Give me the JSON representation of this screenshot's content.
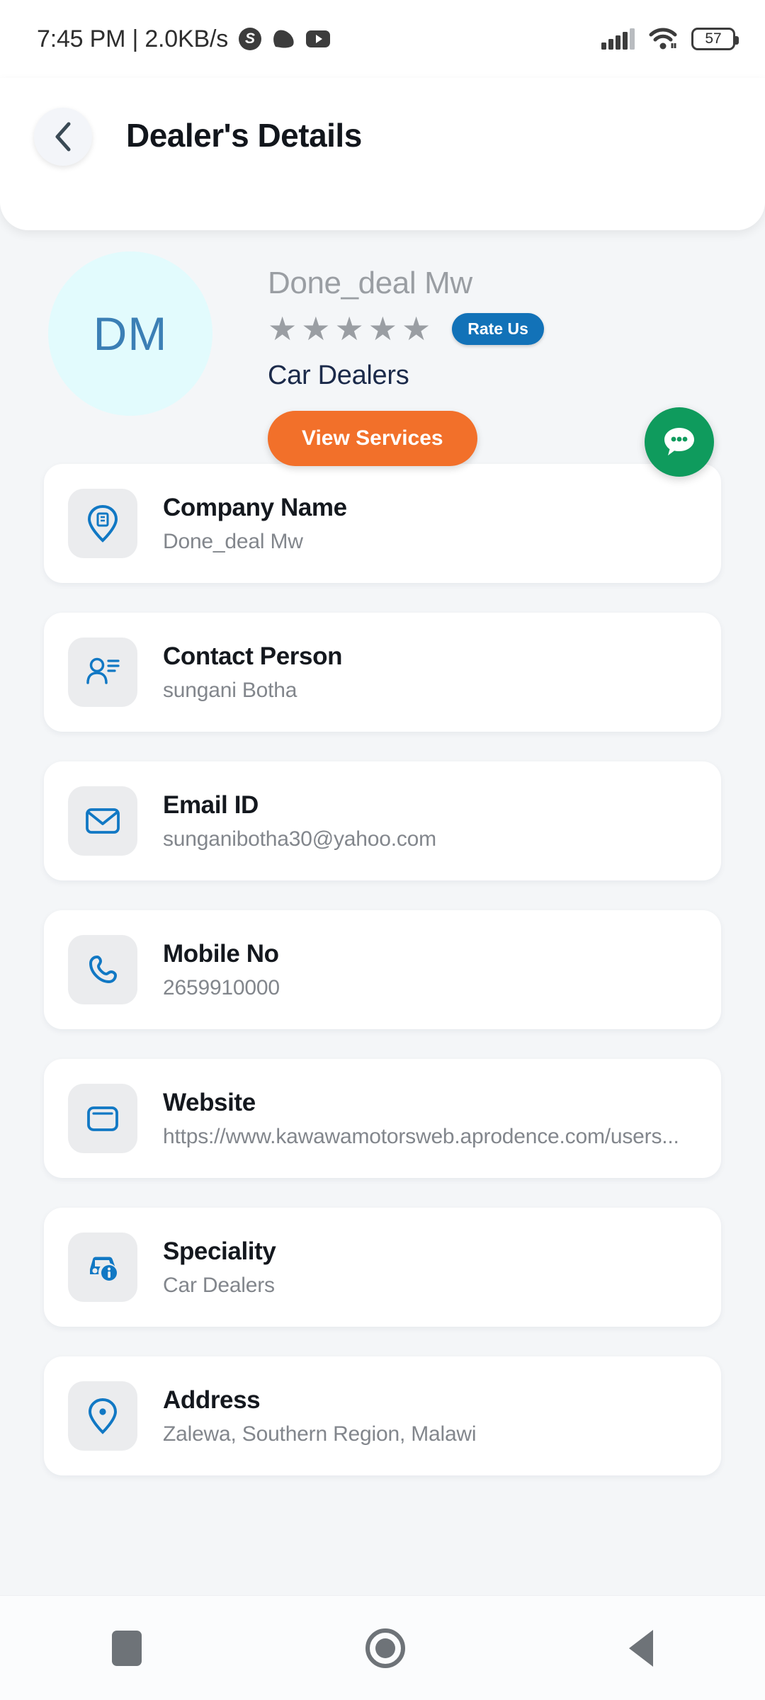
{
  "statusbar": {
    "clock": "7:45 PM | 2.0KB/s",
    "skype_icon": "skype-icon",
    "game_icon": "game-controller-icon",
    "youtube_icon": "youtube-icon",
    "signal_icon": "signal-bars-icon",
    "wifi_icon": "wifi-icon",
    "battery_level": "57"
  },
  "header": {
    "back_icon": "chevron-left-icon",
    "title": "Dealer's Details"
  },
  "profile": {
    "avatar_initials": "DM",
    "name": "Done_deal Mw",
    "stars": [
      "★",
      "★",
      "★",
      "★",
      "★"
    ],
    "star_color": "#9a9ea3",
    "rate_us_label": "Rate Us",
    "rate_us_color": "#1272b8",
    "category": "Car Dealers",
    "view_services_label": "View Services",
    "view_services_color": "#f2702a",
    "chat_fab_icon": "chat-bubble-icon",
    "chat_fab_color": "#0f9b5d"
  },
  "details": [
    {
      "icon": "company-pin-icon",
      "label": "Company Name",
      "value": "Done_deal Mw"
    },
    {
      "icon": "contact-person-icon",
      "label": "Contact Person",
      "value": "sungani Botha"
    },
    {
      "icon": "envelope-icon",
      "label": "Email ID",
      "value": "sunganibotha30@yahoo.com"
    },
    {
      "icon": "phone-icon",
      "label": "Mobile No",
      "value": "2659910000"
    },
    {
      "icon": "browser-window-icon",
      "label": "Website",
      "value": "https://www.kawawamotorsweb.aprodence.com/users..."
    },
    {
      "icon": "car-info-icon",
      "label": "Speciality",
      "value": "Car Dealers"
    },
    {
      "icon": "location-pin-icon",
      "label": "Address",
      "value": "Zalewa, Southern Region, Malawi"
    }
  ],
  "navbar": {
    "recents_icon": "square-recents-icon",
    "home_icon": "circle-home-icon",
    "back_icon": "triangle-back-icon"
  }
}
